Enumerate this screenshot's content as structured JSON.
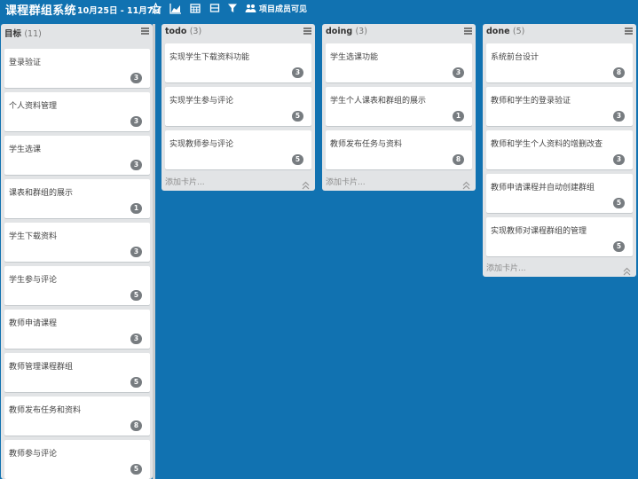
{
  "header": {
    "title": "课程群组系统",
    "date_range": "10月25日 - 11月7日",
    "visibility_label": "项目成员可见",
    "icons": [
      "star-icon",
      "chart-icon",
      "calendar-icon",
      "card-icon",
      "filter-icon",
      "users-icon"
    ]
  },
  "lists": [
    {
      "name": "目标",
      "count": "(11)",
      "cards": [
        {
          "title": "登录验证",
          "badge": "3"
        },
        {
          "title": "个人资料管理",
          "badge": "3"
        },
        {
          "title": "学生选课",
          "badge": "3"
        },
        {
          "title": "课表和群组的展示",
          "badge": "1"
        },
        {
          "title": "学生下载资料",
          "badge": "3"
        },
        {
          "title": "学生参与评论",
          "badge": "5"
        },
        {
          "title": "教师申请课程",
          "badge": "3"
        },
        {
          "title": "教师管理课程群组",
          "badge": "5"
        },
        {
          "title": "教师发布任务和资料",
          "badge": "8"
        },
        {
          "title": "教师参与评论",
          "badge": "5"
        }
      ]
    },
    {
      "name": "todo",
      "count": "(3)",
      "add_label": "添加卡片...",
      "cards": [
        {
          "title": "实现学生下载资料功能",
          "badge": "3"
        },
        {
          "title": "实现学生参与评论",
          "badge": "5"
        },
        {
          "title": "实现教师参与评论",
          "badge": "5"
        }
      ]
    },
    {
      "name": "doing",
      "count": "(3)",
      "add_label": "添加卡片...",
      "cards": [
        {
          "title": "学生选课功能",
          "badge": "3"
        },
        {
          "title": "学生个人课表和群组的展示",
          "badge": "1"
        },
        {
          "title": "教师发布任务与资料",
          "badge": "8"
        }
      ]
    },
    {
      "name": "done",
      "count": "(5)",
      "add_label": "添加卡片...",
      "cards": [
        {
          "title": "系统前台设计",
          "badge": "8"
        },
        {
          "title": "教师和学生的登录验证",
          "badge": "3"
        },
        {
          "title": "教师和学生个人资料的增删改查",
          "badge": "3"
        },
        {
          "title": "教师申请课程并自动创建群组",
          "badge": "5"
        },
        {
          "title": "实现教师对课程群组的管理",
          "badge": "5"
        }
      ]
    }
  ]
}
